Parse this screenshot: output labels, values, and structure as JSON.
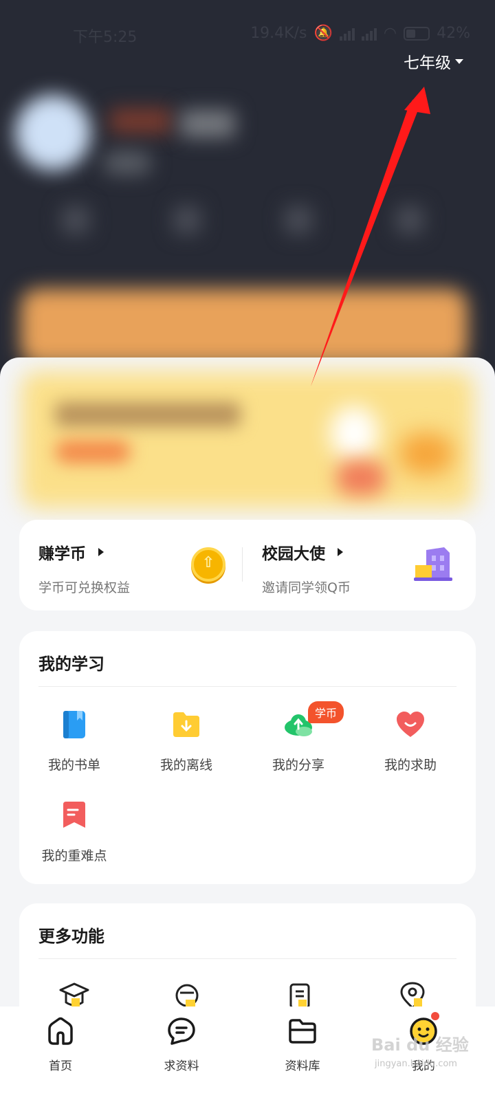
{
  "status_bar": {
    "time": "下午5:25",
    "network_speed": "19.4K/s",
    "battery": "42%"
  },
  "header": {
    "grade": "七年级"
  },
  "earn_card": {
    "items": [
      {
        "title": "赚学币",
        "subtitle": "学币可兑换权益",
        "icon": "coin-icon"
      },
      {
        "title": "校园大使",
        "subtitle": "邀请同学领Q币",
        "icon": "school-building-icon"
      }
    ]
  },
  "my_study": {
    "title": "我的学习",
    "items": [
      {
        "label": "我的书单",
        "icon": "book-icon",
        "color": "#2a9df4"
      },
      {
        "label": "我的离线",
        "icon": "folder-download-icon",
        "color": "#ffcc33"
      },
      {
        "label": "我的分享",
        "icon": "cloud-upload-icon",
        "color": "#22c46a"
      },
      {
        "label": "我的求助",
        "icon": "heart-icon",
        "color": "#f25d5d"
      },
      {
        "label": "我的重难点",
        "icon": "bookmark-icon",
        "color": "#f25d5d"
      }
    ],
    "share_badge": "学币"
  },
  "more_features": {
    "title": "更多功能",
    "icons": [
      "graduation-cap-icon",
      "mascot-icon",
      "clipboard-icon",
      "location-pin-icon"
    ]
  },
  "bottom_nav": {
    "items": [
      {
        "label": "首页",
        "icon": "home-icon"
      },
      {
        "label": "求资料",
        "icon": "chat-bubble-icon"
      },
      {
        "label": "资料库",
        "icon": "folder-icon"
      },
      {
        "label": "我的",
        "icon": "profile-mascot-icon"
      }
    ]
  },
  "watermark": {
    "text": "Bai du 经验",
    "sub": "jingyan.baidu.com"
  },
  "colors": {
    "header_bg": "#272a35",
    "accent_yellow": "#ffd233",
    "annotation_red": "#ff1a1a"
  }
}
